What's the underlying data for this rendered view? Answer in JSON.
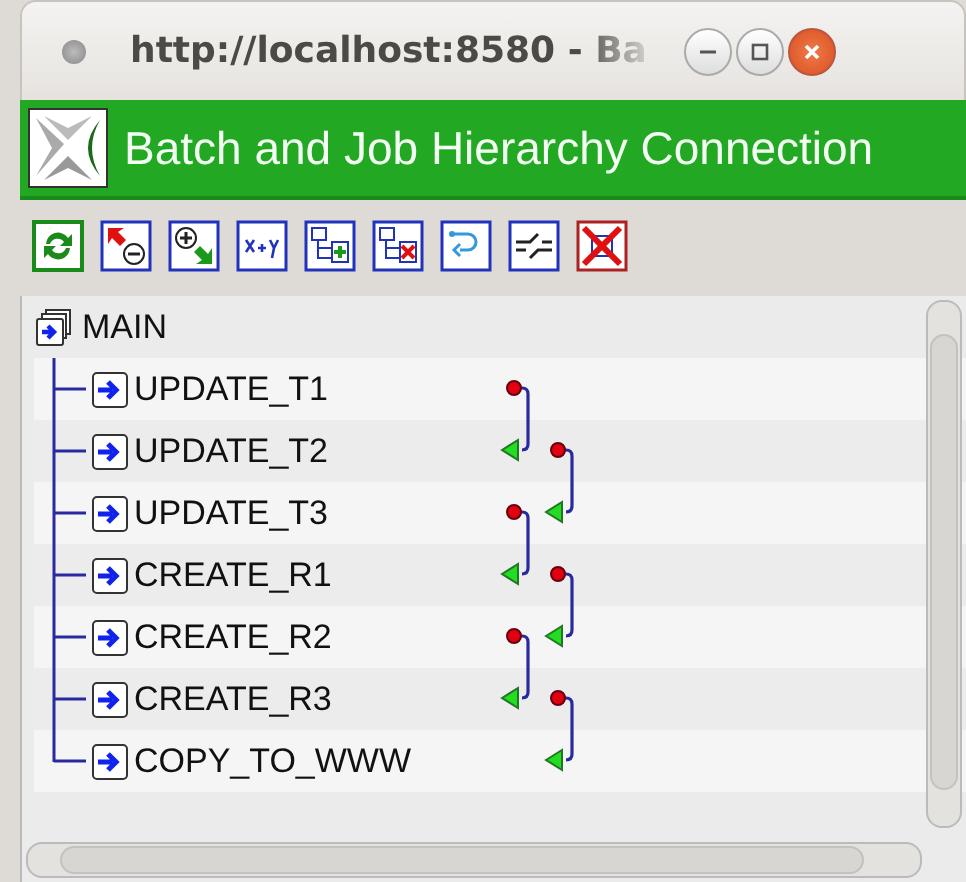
{
  "window": {
    "title": "http://localhost:8580 - Ba"
  },
  "header": {
    "title": "Batch and Job Hierarchy Connection"
  },
  "toolbar": [
    {
      "kind": "refresh"
    },
    {
      "kind": "remove"
    },
    {
      "kind": "add"
    },
    {
      "kind": "variables"
    },
    {
      "kind": "add-node"
    },
    {
      "kind": "delete-node"
    },
    {
      "kind": "link"
    },
    {
      "kind": "switch"
    },
    {
      "kind": "close"
    }
  ],
  "tree": {
    "label": "MAIN",
    "children": [
      {
        "label": "UPDATE_T1"
      },
      {
        "label": "UPDATE_T2"
      },
      {
        "label": "UPDATE_T3"
      },
      {
        "label": "CREATE_R1"
      },
      {
        "label": "CREATE_R2"
      },
      {
        "label": "CREATE_R3"
      },
      {
        "label": "COPY_TO_WWW"
      }
    ]
  }
}
